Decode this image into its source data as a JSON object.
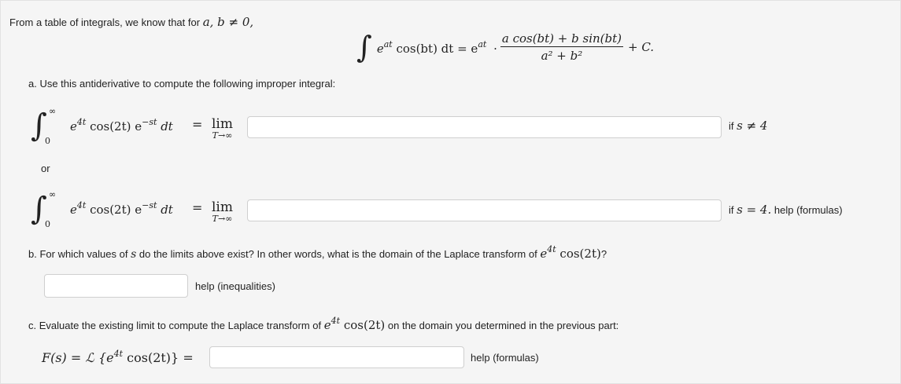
{
  "intro": {
    "text": "From a table of integrals, we know that for",
    "condition": "a, b ≠ 0,"
  },
  "formula": {
    "integral_sign": "∫",
    "integrand": "e",
    "integrand_exp": "at",
    "integrand_rest": " cos(bt) dt = e",
    "rhs_exp": "at",
    "dot": "·",
    "numerator": "a cos(bt) + b sin(bt)",
    "denominator": "a² + b²",
    "constant": "+ C."
  },
  "part_a": {
    "prompt": "a. Use this antiderivative to compute the following improper integral:",
    "upper_limit": "∞",
    "lower_limit": "0",
    "integrand": "e",
    "exp1": "4t",
    "mid": " cos(2t) e",
    "exp2": "−st",
    "dt": " dt",
    "equals": "=",
    "lim_word": "lim",
    "lim_sub": "T→∞",
    "row1": {
      "answer_value": "",
      "condition_prefix": "if",
      "condition": "s ≠ 4"
    },
    "or_label": "or",
    "row2": {
      "answer_value": "",
      "condition_prefix": "if",
      "condition": "s = 4.",
      "help_label": "help (formulas)"
    }
  },
  "part_b": {
    "prompt_before": "b. For which values of",
    "variable": "s",
    "prompt_after": "do the limits above exist? In other words, what is the domain of the Laplace transform of",
    "fn_e": "e",
    "fn_exp": "4t",
    "fn_rest": " cos(2t)",
    "prompt_end": "?",
    "answer_value": "",
    "help_label": "help (inequalities)"
  },
  "part_c": {
    "prompt_before": "c. Evaluate the existing limit to compute the Laplace transform of",
    "fn_e": "e",
    "fn_exp": "4t",
    "fn_rest": " cos(2t)",
    "prompt_after": "on the domain you determined in the previous part:",
    "lhs": "F(s) = ℒ {e",
    "lhs_exp": "4t",
    "lhs_rest": " cos(2t)} =",
    "answer_value": "",
    "help_label": "help (formulas)"
  }
}
